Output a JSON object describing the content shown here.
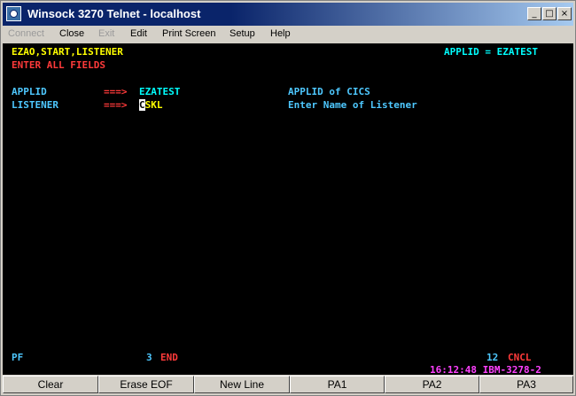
{
  "window": {
    "title": "Winsock 3270 Telnet - localhost",
    "controls": {
      "minimize": "_",
      "maximize": "□",
      "close": "×"
    }
  },
  "menu": {
    "items": [
      {
        "label": "Connect",
        "disabled": true
      },
      {
        "label": "Close",
        "disabled": false
      },
      {
        "label": "Exit",
        "disabled": true
      },
      {
        "label": "Edit",
        "disabled": false
      },
      {
        "label": "Print Screen",
        "disabled": false
      },
      {
        "label": "Setup",
        "disabled": false
      },
      {
        "label": "Help",
        "disabled": false
      }
    ]
  },
  "terminal": {
    "transaction": "EZAO,START,LISTENER",
    "applid_header": "APPLID = EZATEST",
    "message": "ENTER ALL FIELDS",
    "fields": [
      {
        "label": "APPLID",
        "arrow": "===>",
        "value": "EZATEST",
        "description": "APPLID of CICS"
      },
      {
        "label": "LISTENER",
        "arrow": "===>",
        "cursor_char": "C",
        "value_rest": "SKL",
        "description": "Enter Name of Listener"
      }
    ],
    "pf_label": "PF",
    "pf3_key": "3",
    "pf3_action": "END",
    "pf12_key": "12",
    "pf12_action": "CNCL",
    "status": "16:12:48 IBM-3278-2"
  },
  "function_keys": [
    "Clear",
    "Erase EOF",
    "New Line",
    "PA1",
    "PA2",
    "PA3"
  ],
  "colors": {
    "terminal_bg": "#000000",
    "title_bar": "#0a246a"
  }
}
